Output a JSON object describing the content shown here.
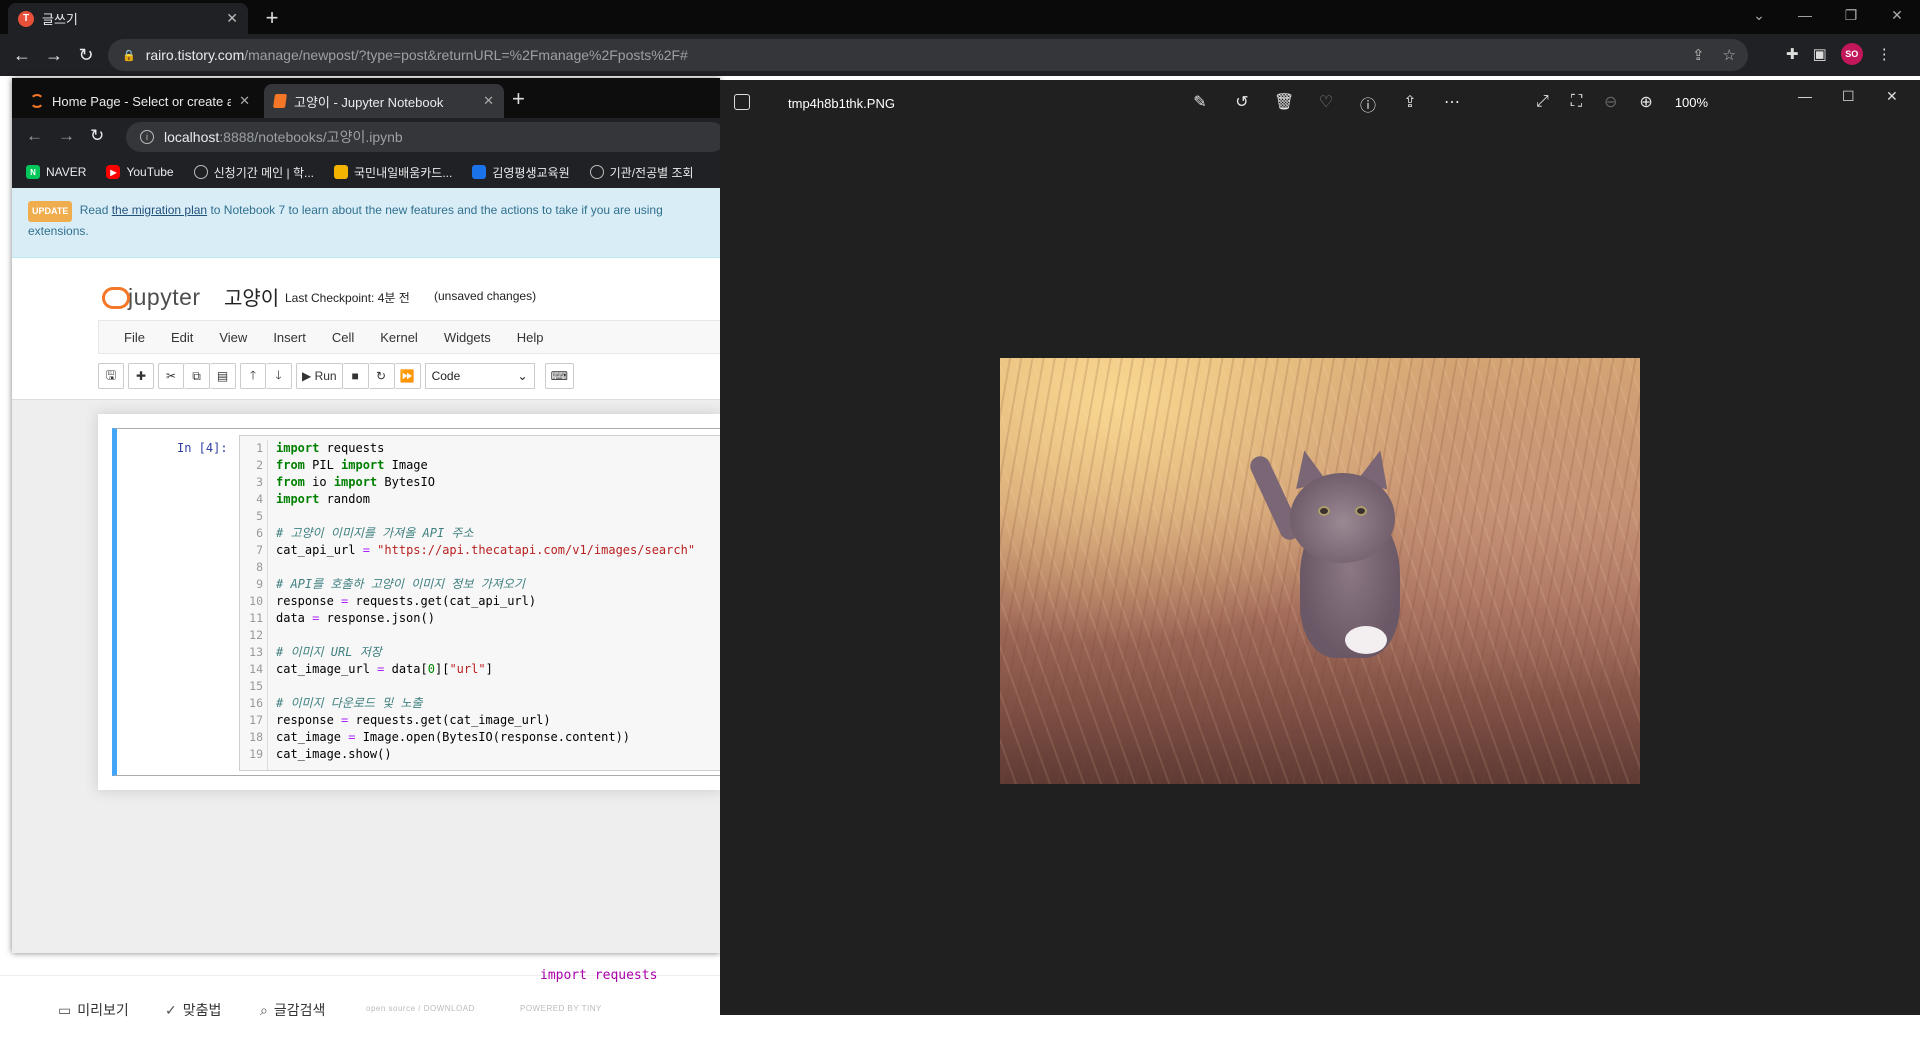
{
  "outer_browser": {
    "tab_title": "글쓰기",
    "url_host": "rairo.tistory.com",
    "url_path": "/manage/newpost/?type=post&returnURL=%2Fmanage%2Fposts%2F#",
    "profile_initials": "SO"
  },
  "inner_browser": {
    "tabs": [
      {
        "title": "Home Page - Select or create a"
      },
      {
        "title": "고양이 - Jupyter Notebook"
      }
    ],
    "url_host": "localhost",
    "url_rest": ":8888/notebooks/고양이.ipynb",
    "bookmarks": [
      {
        "label": "NAVER",
        "icon": "naver-icon"
      },
      {
        "label": "YouTube",
        "icon": "youtube-icon"
      },
      {
        "label": "신청기간 메인 | 학...",
        "icon": "globe-icon"
      },
      {
        "label": "국민내일배움카드...",
        "icon": "card-icon"
      },
      {
        "label": "김영평생교육원",
        "icon": "school-icon"
      },
      {
        "label": "기관/전공별 조회",
        "icon": "globe-icon"
      }
    ]
  },
  "banner": {
    "badge": "UPDATE",
    "text_before": "Read",
    "link": "the migration plan",
    "text_after": "to Notebook 7 to learn about the new features and the actions to take if you are using",
    "text_line2": "extensions."
  },
  "jupyter": {
    "logo_text": "jupyter",
    "notebook_name": "고양이",
    "checkpoint": "Last Checkpoint: 4분 전",
    "unsaved": "(unsaved changes)",
    "menu": [
      "File",
      "Edit",
      "View",
      "Insert",
      "Cell",
      "Kernel",
      "Widgets",
      "Help"
    ],
    "toolbar": {
      "run_label": "Run",
      "cell_type": "Code"
    },
    "cell": {
      "prompt": "In [4]:",
      "line_numbers": [
        "1",
        "2",
        "3",
        "4",
        "5",
        "6",
        "7",
        "8",
        "9",
        "10",
        "11",
        "12",
        "13",
        "14",
        "15",
        "16",
        "17",
        "18",
        "19"
      ]
    }
  },
  "tistory": {
    "preview": "미리보기",
    "spellcheck": "맞춤법",
    "search": "글감검색",
    "opensource": "open source / DOWNLOAD",
    "powered": "POWERED BY TINY",
    "ghost_code": "import requests"
  },
  "viewer": {
    "filename": "tmp4h8b1thk.PNG",
    "zoom": "100%"
  },
  "colors": {
    "jupyter_orange": "#f37726",
    "cell_selected": "#42a5f5",
    "viewer_bg": "#202020"
  }
}
